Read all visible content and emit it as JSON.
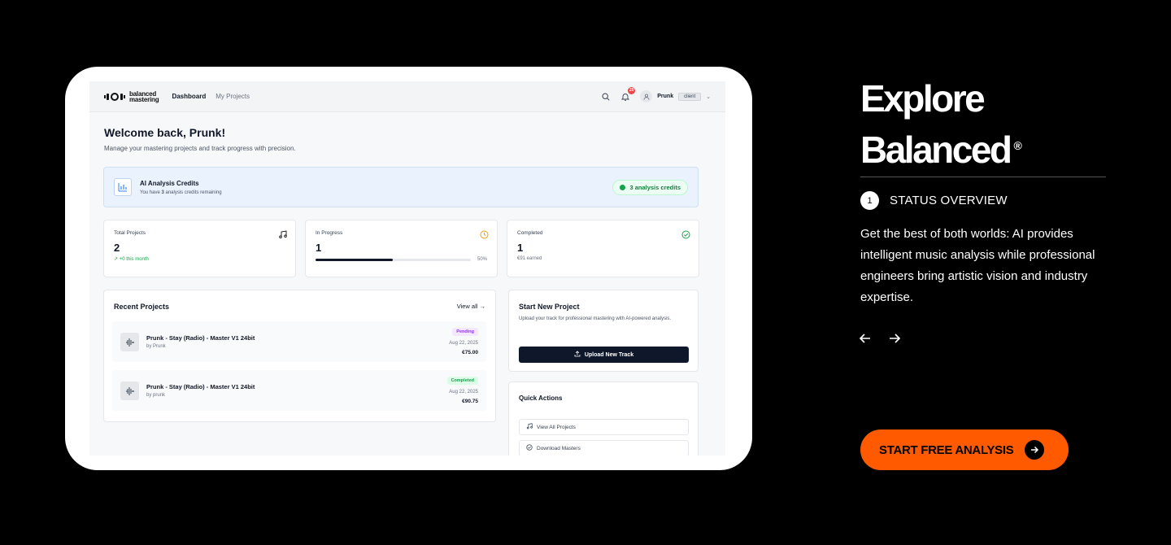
{
  "app": {
    "logo_line1": "balanced",
    "logo_line2": "mastering",
    "nav": [
      "Dashboard",
      "My Projects"
    ],
    "notification_count": "20",
    "user_name": "Prunk",
    "user_role": "client",
    "welcome_title": "Welcome back, Prunk!",
    "welcome_sub": "Manage your mastering projects and track progress with precision.",
    "credits": {
      "title": "AI Analysis Credits",
      "sub_prefix": "You have ",
      "count": "3",
      "sub_suffix": " analysis credits remaining",
      "pill": "3 analysis credits"
    },
    "stats": {
      "total": {
        "label": "Total Projects",
        "value": "2",
        "foot": "+0 this month"
      },
      "progress": {
        "label": "In Progress",
        "value": "1",
        "percent_label": "50%",
        "fraction": 0.5
      },
      "completed": {
        "label": "Completed",
        "value": "1",
        "foot": "€91 earned"
      }
    },
    "recent": {
      "title": "Recent Projects",
      "view_all": "View all →",
      "items": [
        {
          "title": "Prunk - Stay (Radio) - Master V1 24bit",
          "by": "by Prunk",
          "status": "Pending",
          "date": "Aug 22, 2025",
          "price": "€75.00"
        },
        {
          "title": "Prunk - Stay (Radio) - Master V1 24bit",
          "by": "by prunk",
          "status": "Completed",
          "date": "Aug 22, 2025",
          "price": "€90.75"
        }
      ]
    },
    "start": {
      "title": "Start New Project",
      "sub": "Upload your track for professional mastering with AI-powered analysis.",
      "button": "Upload New Track"
    },
    "quick": {
      "title": "Quick Actions",
      "items": [
        "View All Projects",
        "Download Masters"
      ]
    }
  },
  "side": {
    "title_line1": "Explore",
    "title_line2": "Balanced",
    "registered": "®",
    "step_number": "1",
    "step_label": "STATUS OVERVIEW",
    "description": "Get the best of both worlds: AI provides intelligent music analysis while professional engineers bring artistic vision and industry expertise.",
    "cta": "START FREE ANALYSIS"
  },
  "colors": {
    "accent": "#ff5a00",
    "background": "#000000"
  }
}
